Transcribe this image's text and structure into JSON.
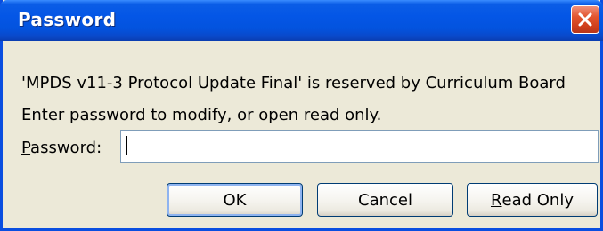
{
  "window": {
    "title": "Password",
    "close_icon": "close-icon"
  },
  "message": {
    "line1": "'MPDS v11-3 Protocol Update Final' is reserved by Curriculum Board",
    "line2": "Enter password to modify, or open read only."
  },
  "password": {
    "label_mnemonic": "P",
    "label_rest": "assword:",
    "value": ""
  },
  "buttons": {
    "ok": "OK",
    "cancel": "Cancel",
    "readonly_mnemonic": "R",
    "readonly_rest": "ead Only"
  },
  "colors": {
    "titlebar": "#0456e6",
    "close_button": "#e2552f",
    "dialog_background": "#ece9d8"
  }
}
